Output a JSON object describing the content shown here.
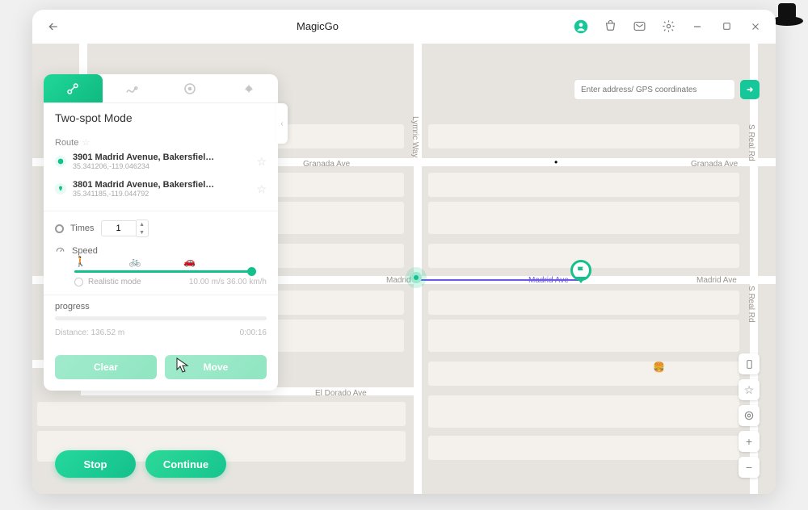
{
  "app": {
    "title": "MagicGo"
  },
  "search": {
    "placeholder": "Enter address/ GPS coordinates"
  },
  "panel": {
    "title": "Two-spot Mode",
    "route_label": "Route",
    "waypoints": [
      {
        "address": "3901 Madrid Avenue, Bakersfiel…",
        "coords": "35.341206,-119.046234"
      },
      {
        "address": "3801 Madrid Avenue, Bakersfiel…",
        "coords": "35.341185,-119.044792"
      }
    ],
    "times_label": "Times",
    "times_value": "1",
    "speed_label": "Speed",
    "realistic_label": "Realistic mode",
    "speed_values": "10.00 m/s  36.00 km/h",
    "progress_label": "progress",
    "distance_label": "Distance: 136.52 m",
    "elapsed": "0:00:16",
    "buttons": {
      "clear": "Clear",
      "move": "Move"
    }
  },
  "controls": {
    "stop": "Stop",
    "continue": "Continue"
  },
  "map": {
    "streets": {
      "granada_left": "Granada Ave",
      "granada_right": "Granada Ave",
      "madrid_left": "Madrid",
      "madrid_center": "Madrid Ave",
      "madrid_right": "Madrid Ave",
      "eldorado": "El Dorado Ave",
      "lymric": "Lymric Way",
      "real_top": "S Real Rd",
      "real_bottom": "S Real Rd"
    }
  },
  "colors": {
    "accent": "#14c08b"
  }
}
